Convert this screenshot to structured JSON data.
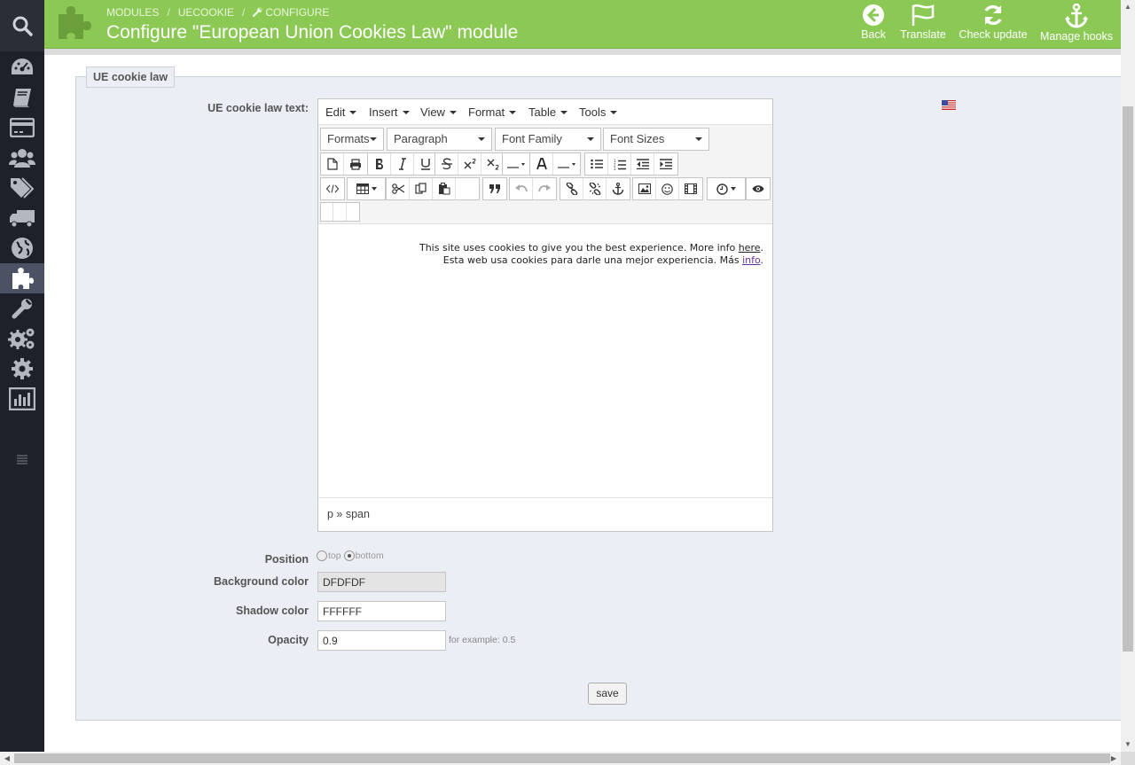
{
  "sidebar": {
    "items": [
      {
        "icon": "dashboard-icon"
      },
      {
        "icon": "catalog-icon"
      },
      {
        "icon": "orders-icon"
      },
      {
        "icon": "customers-icon"
      },
      {
        "icon": "price-rules-icon"
      },
      {
        "icon": "shipping-icon"
      },
      {
        "icon": "localization-icon"
      },
      {
        "icon": "modules-icon",
        "active": true
      },
      {
        "icon": "preferences-icon"
      },
      {
        "icon": "advanced-parameters-icon"
      },
      {
        "icon": "administration-icon"
      },
      {
        "icon": "stats-icon"
      }
    ]
  },
  "header": {
    "breadcrumb": [
      "MODULES",
      "UECOOKIE",
      "CONFIGURE"
    ],
    "breadcrumb_sep": "/",
    "title": "Configure \"European Union Cookies Law\" module",
    "toolbar": {
      "back": "Back",
      "translate": "Translate",
      "check_update": "Check update",
      "manage_hooks": "Manage hooks"
    },
    "accent_color": "#8bc954"
  },
  "panel": {
    "tab_label": "UE cookie law",
    "text_label": "UE cookie law text:",
    "flag": "us-flag-icon"
  },
  "editor": {
    "menu": [
      "Edit",
      "Insert",
      "View",
      "Format",
      "Table",
      "Tools"
    ],
    "selects": {
      "formats": "Formats",
      "paragraph": "Paragraph",
      "font_family": "Font Family",
      "font_sizes": "Font Sizes"
    },
    "content": {
      "line1_text": "This site uses cookies to give you the best experience.  More info ",
      "line1_link": "here",
      "line1_end": ".",
      "line2_text": "Esta web usa cookies para darle una mejor experiencia. Más ",
      "line2_link": "info",
      "line2_end": "."
    },
    "status_path": "p » span"
  },
  "form": {
    "position_label": "Position",
    "position_top": "top",
    "position_bottom": "bottom",
    "position_value": "bottom",
    "bg_color_label": "Background color",
    "bg_color_value": "DFDFDF",
    "shadow_color_label": "Shadow color",
    "shadow_color_value": "FFFFFF",
    "opacity_label": "Opacity",
    "opacity_value": "0.9",
    "opacity_hint": "for example: 0.5",
    "save_label": "save"
  }
}
